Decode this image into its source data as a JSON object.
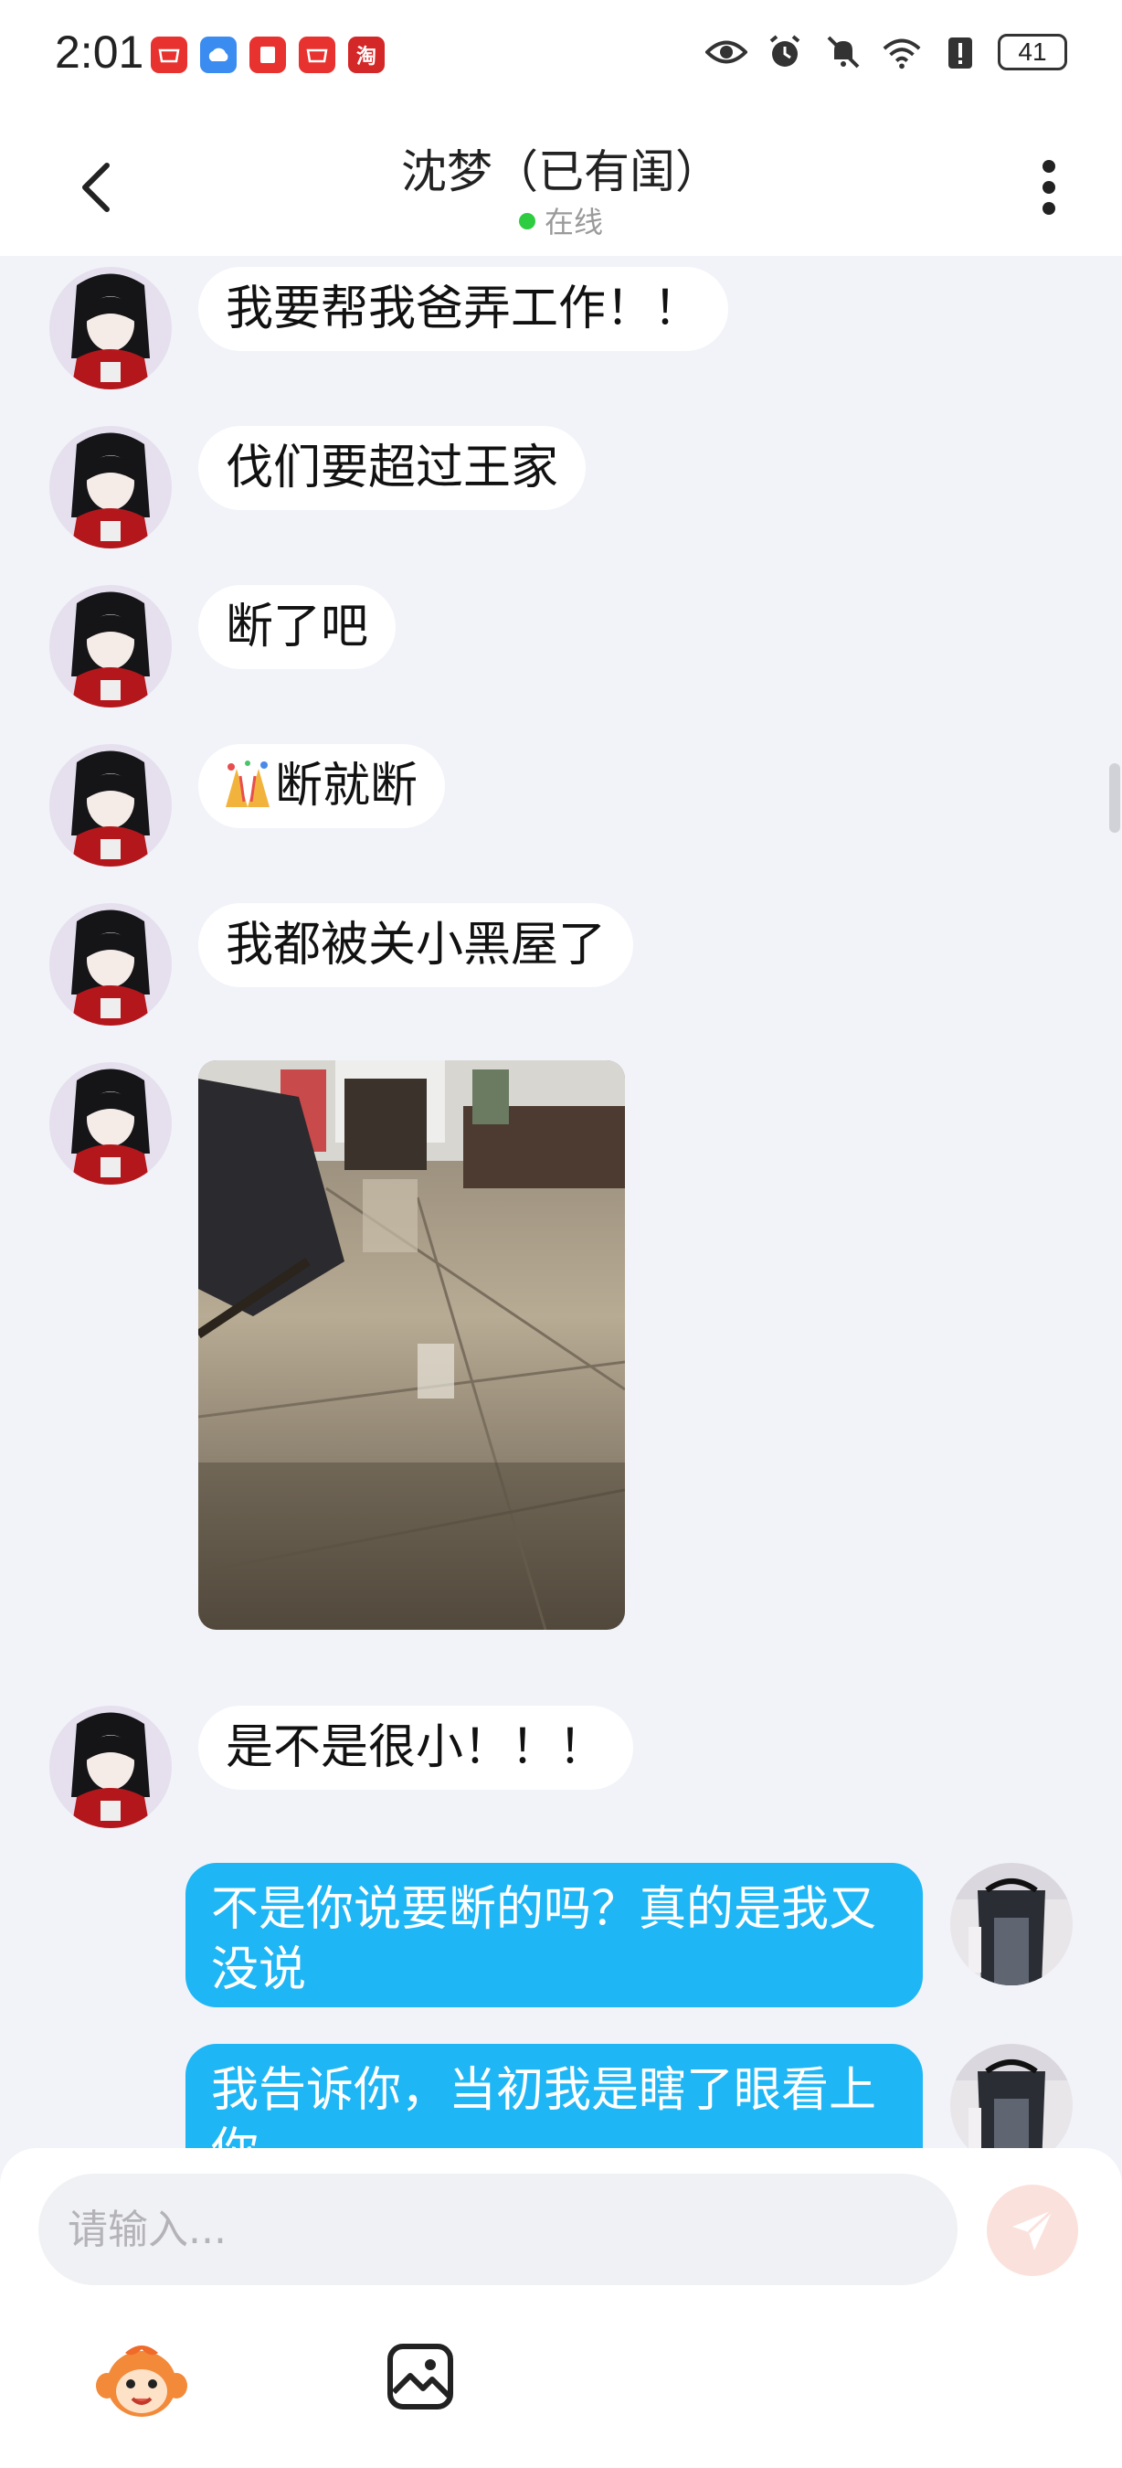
{
  "status_bar": {
    "time": "2:01",
    "taobao_glyph": "淘",
    "battery": "41",
    "icons": [
      "huawei-mall-icon",
      "cloud-icon",
      "notes-icon",
      "huawei-store-icon",
      "taobao-icon",
      "eye-icon",
      "alarm-icon",
      "mute-icon",
      "wifi-icon",
      "alert-icon",
      "battery-icon"
    ]
  },
  "header": {
    "title": "沈梦（已有闺）",
    "status": "在线",
    "status_color": "#2ecc40"
  },
  "messages": [
    {
      "side": "in",
      "text": "我要帮我爸弄工作！！"
    },
    {
      "side": "in",
      "text": "伐们要超过王家"
    },
    {
      "side": "in",
      "text": "断了吧"
    },
    {
      "side": "in",
      "emoji": "party-popper-icon",
      "text": "断就断"
    },
    {
      "side": "in",
      "text": "我都被关小黑屋了"
    },
    {
      "side": "in",
      "type": "image",
      "description_icon": "room-photo"
    },
    {
      "side": "in",
      "text": "是不是很小！！！"
    },
    {
      "side": "out",
      "text": "不是你说要断的吗？真的是我又没说"
    },
    {
      "side": "out",
      "text": "我告诉你，当初我是瞎了眼看上你"
    }
  ],
  "composer": {
    "placeholder": "请输入...",
    "send_icon": "send-icon",
    "tools": [
      "monkey-emoji-icon",
      "image-icon"
    ]
  },
  "colors": {
    "outgoing_bubble": "#1eb6f5",
    "incoming_bubble": "#ffffff",
    "background": "#f1f3f8",
    "send_button": "#fbe1dc"
  }
}
